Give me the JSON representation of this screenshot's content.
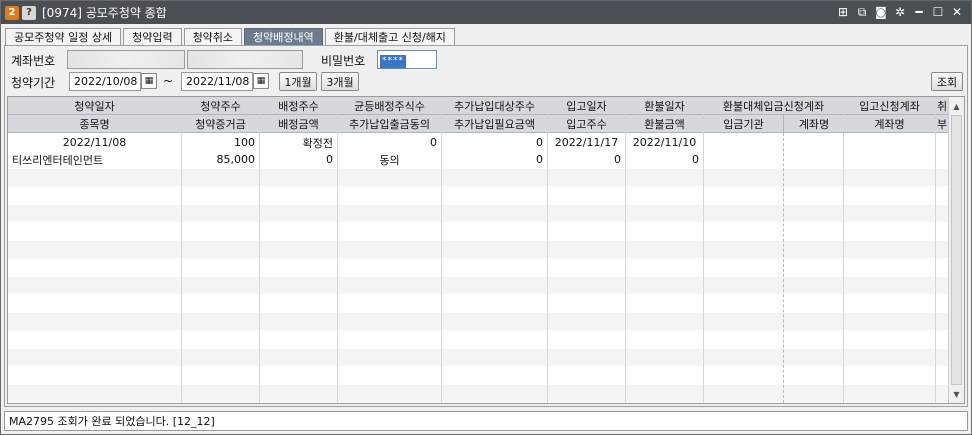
{
  "window": {
    "badge_num": "2",
    "badge_help": "?",
    "title": "[0974] 공모주청약 종합",
    "tools": [
      "pin-icon",
      "link-icon",
      "camera-icon",
      "gear-icon",
      "minimize-icon",
      "maximize-icon",
      "close-icon"
    ]
  },
  "tabs": [
    {
      "label": "공모주청약 일정 상세",
      "active": false
    },
    {
      "label": "청약입력",
      "active": false
    },
    {
      "label": "청약취소",
      "active": false
    },
    {
      "label": "청약배정내역",
      "active": true
    },
    {
      "label": "환불/대체출고 신청/해지",
      "active": false
    }
  ],
  "form": {
    "account_label": "계좌번호",
    "password_label": "비밀번호",
    "password_value": "****",
    "period_label": "청약기간",
    "date_from": "2022/10/08",
    "tilde": "~",
    "date_to": "2022/11/08",
    "btn_1month": "1개월",
    "btn_3month": "3개월",
    "btn_query": "조회"
  },
  "grid": {
    "columns": [
      {
        "h1": "청약일자",
        "h2": "종목명"
      },
      {
        "h1": "청약주수",
        "h2": "청약증거금"
      },
      {
        "h1": "배정주수",
        "h2": "배정금액"
      },
      {
        "h1": "균등배정주식수",
        "h2": "추가납입출금동의"
      },
      {
        "h1": "추가납입대상주수",
        "h2": "추가납입필요금액"
      },
      {
        "h1": "입고일자",
        "h2": "입고주수"
      },
      {
        "h1": "환불일자",
        "h2": "환불금액"
      },
      {
        "h1": "환불대체입금신청계좌",
        "h2a": "입금기관",
        "h2b": "계좌명"
      },
      {
        "h1": "입고신청계좌",
        "h2": "계좌명"
      },
      {
        "h1": "취",
        "h2": "부"
      }
    ],
    "rows": [
      [
        "2022/11/08",
        "100",
        "확정전",
        "0",
        "0",
        "2022/11/17",
        "2022/11/10",
        "",
        "",
        "",
        ""
      ],
      [
        "티쓰리엔터테인먼트",
        "85,000",
        "0",
        "동의",
        "0",
        "0",
        "0",
        "",
        "",
        "",
        ""
      ]
    ]
  },
  "status": "MA2795 조회가 완료 되었습니다. [12_12]",
  "colors": {
    "titlebar": "#4a4e55",
    "active_tab": "#6d7c8c",
    "header": "#d5d9de",
    "badge": "#e07a1a"
  }
}
